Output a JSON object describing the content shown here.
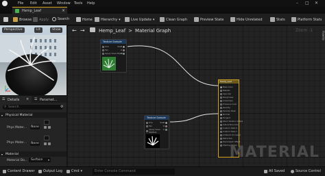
{
  "menu": [
    "File",
    "Edit",
    "Asset",
    "Window",
    "Tools",
    "Help"
  ],
  "document_tab": {
    "label": "Hemp_Leaf"
  },
  "toolbar": {
    "save": "",
    "browse": "Browse",
    "apply": "Apply",
    "search": "Search",
    "home": "Home",
    "hierarchy": "Hierarchy",
    "live_update": "Live Update",
    "clean_graph": "Clean Graph",
    "preview_state": "Preview State",
    "hide_unrelated": "Hide Unrelated",
    "stats": "Stats",
    "platform_stats": "Platform Stats"
  },
  "viewport": {
    "perspective": "Perspective",
    "lit": "Lit",
    "show": "Show"
  },
  "details": {
    "tab_details": "Details",
    "tab_params": "Paramet...",
    "search_placeholder": "Search",
    "physical_material": "Physical Material",
    "phys_mater_1": "Phys Mater...",
    "phys_mater_2": "Phys Mater...",
    "none_1": "None",
    "none_2": "None",
    "material_section": "Material",
    "material_domain_label": "Material Do...",
    "material_domain_value": "Surface"
  },
  "graph": {
    "breadcrumb_asset": "Hemp_Leaf",
    "breadcrumb_sep": ">",
    "breadcrumb_graph": "Material Graph",
    "zoom": "Zoom -1",
    "palette": "Palette",
    "watermark": "MATERIAL",
    "node1_title": "Texture Sample",
    "node2_title": "Texture Sample",
    "result_title": "Hemp_Leaf",
    "texture_pins": [
      "UVs",
      "Tex",
      "Apply View MipBias"
    ],
    "texture_outputs": [
      "RGB",
      "R",
      "G",
      "B",
      "A",
      "RGBA"
    ],
    "result_pins": [
      "Base Color",
      "Metallic",
      "Specular",
      "Roughness",
      "Anisotropy",
      "Emissive Color",
      "Opacity",
      "Opacity Mask",
      "Normal",
      "Tangent",
      "World Position Offset",
      "Subsurface Color",
      "Custom Data 0",
      "Custom Data 1",
      "Ambient Occlusion",
      "Refraction",
      "Pixel Depth Offset",
      "Shading Model"
    ]
  },
  "status": {
    "content_drawer": "Content Drawer",
    "output_log": "Output Log",
    "cmd": "Cmd",
    "console_placeholder": "Enter Console Command",
    "all_saved": "All Saved",
    "source_control": "Source Control"
  },
  "colors": {
    "accent": "#d4a21e",
    "node_header": "#1d3a5c",
    "result_header": "#6b5a1d"
  }
}
